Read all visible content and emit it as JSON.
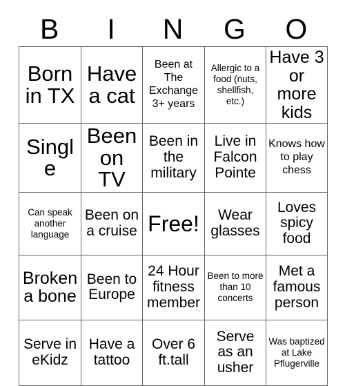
{
  "card": {
    "title": "BINGO",
    "header_letters": [
      "B",
      "I",
      "N",
      "G",
      "O"
    ],
    "columns": 5,
    "rows": 5,
    "free_space": {
      "row": 3,
      "column": 3,
      "label": "Free!"
    },
    "colors": {
      "text": "#000000",
      "background": "#ffffff",
      "border": "#666666"
    },
    "squares": [
      [
        {
          "text": "Born in TX",
          "size": "xl"
        },
        {
          "text": "Have a cat",
          "size": "xl"
        },
        {
          "text": "Been at The Exchange 3+ years",
          "size": "sm"
        },
        {
          "text": "Allergic to a food (nuts, shellfish, etc.)",
          "size": "xs"
        },
        {
          "text": "Have 3 or more kids",
          "size": "lg"
        }
      ],
      [
        {
          "text": "Single",
          "size": "xl"
        },
        {
          "text": "Been on TV",
          "size": "xl"
        },
        {
          "text": "Been in the military",
          "size": "md"
        },
        {
          "text": "Live in Falcon Pointe",
          "size": "md"
        },
        {
          "text": "Knows how to play chess",
          "size": "sm"
        }
      ],
      [
        {
          "text": "Can speak another language",
          "size": "xs"
        },
        {
          "text": "Been on a cruise",
          "size": "md"
        },
        {
          "text": "Free!",
          "size": "free"
        },
        {
          "text": "Wear glasses",
          "size": "md"
        },
        {
          "text": "Loves spicy food",
          "size": "md"
        }
      ],
      [
        {
          "text": "Broken a bone",
          "size": "lg"
        },
        {
          "text": "Been to Europe",
          "size": "md"
        },
        {
          "text": "24 Hour fitness member",
          "size": "md"
        },
        {
          "text": "Been to more than 10 concerts",
          "size": "xs"
        },
        {
          "text": "Met a famous person",
          "size": "md"
        }
      ],
      [
        {
          "text": "Serve in eKidz",
          "size": "md"
        },
        {
          "text": "Have a tattoo",
          "size": "md"
        },
        {
          "text": "Over 6 ft.tall",
          "size": "md"
        },
        {
          "text": "Serve as an usher",
          "size": "md"
        },
        {
          "text": "Was baptized at Lake Pflugerville",
          "size": "xs"
        }
      ]
    ]
  }
}
